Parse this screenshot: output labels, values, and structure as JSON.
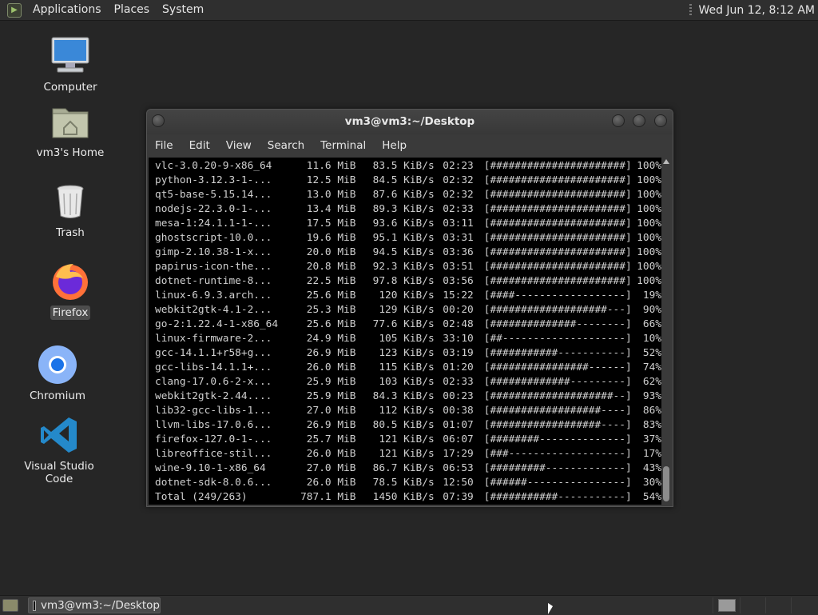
{
  "top_panel": {
    "menus": [
      "Applications",
      "Places",
      "System"
    ],
    "clock": "Wed Jun 12,  8:12 AM"
  },
  "desktop_icons": {
    "computer": "Computer",
    "home": "vm3's Home",
    "trash": "Trash",
    "firefox": "Firefox",
    "chromium": "Chromium",
    "vscode": "Visual Studio Code"
  },
  "terminal": {
    "title": "vm3@vm3:~/Desktop",
    "menu": [
      "File",
      "Edit",
      "View",
      "Search",
      "Terminal",
      "Help"
    ],
    "rows": [
      {
        "name": "vlc-3.0.20-9-x86_64",
        "size": "11.6 MiB",
        "speed": "83.5 KiB/s",
        "eta": "02:23",
        "bar": "[######################]",
        "pct": "100%"
      },
      {
        "name": "python-3.12.3-1-...",
        "size": "12.5 MiB",
        "speed": "84.5 KiB/s",
        "eta": "02:32",
        "bar": "[######################]",
        "pct": "100%"
      },
      {
        "name": "qt5-base-5.15.14...",
        "size": "13.0 MiB",
        "speed": "87.6 KiB/s",
        "eta": "02:32",
        "bar": "[######################]",
        "pct": "100%"
      },
      {
        "name": "nodejs-22.3.0-1-...",
        "size": "13.4 MiB",
        "speed": "89.3 KiB/s",
        "eta": "02:33",
        "bar": "[######################]",
        "pct": "100%"
      },
      {
        "name": "mesa-1:24.1.1-1-...",
        "size": "17.5 MiB",
        "speed": "93.6 KiB/s",
        "eta": "03:11",
        "bar": "[######################]",
        "pct": "100%"
      },
      {
        "name": "ghostscript-10.0...",
        "size": "19.6 MiB",
        "speed": "95.1 KiB/s",
        "eta": "03:31",
        "bar": "[######################]",
        "pct": "100%"
      },
      {
        "name": "gimp-2.10.38-1-x...",
        "size": "20.0 MiB",
        "speed": "94.5 KiB/s",
        "eta": "03:36",
        "bar": "[######################]",
        "pct": "100%"
      },
      {
        "name": "papirus-icon-the...",
        "size": "20.8 MiB",
        "speed": "92.3 KiB/s",
        "eta": "03:51",
        "bar": "[######################]",
        "pct": "100%"
      },
      {
        "name": "dotnet-runtime-8...",
        "size": "22.5 MiB",
        "speed": "97.8 KiB/s",
        "eta": "03:56",
        "bar": "[######################]",
        "pct": "100%"
      },
      {
        "name": "linux-6.9.3.arch...",
        "size": "25.6 MiB",
        "speed": "120 KiB/s",
        "eta": "15:22",
        "bar": "[####------------------]",
        "pct": "19%"
      },
      {
        "name": "webkit2gtk-4.1-2...",
        "size": "25.3 MiB",
        "speed": "129 KiB/s",
        "eta": "00:20",
        "bar": "[###################---]",
        "pct": "90%"
      },
      {
        "name": "go-2:1.22.4-1-x86_64",
        "size": "25.6 MiB",
        "speed": "77.6 KiB/s",
        "eta": "02:48",
        "bar": "[##############--------]",
        "pct": "66%"
      },
      {
        "name": "linux-firmware-2...",
        "size": "24.9 MiB",
        "speed": "105 KiB/s",
        "eta": "33:10",
        "bar": "[##--------------------]",
        "pct": "10%"
      },
      {
        "name": "gcc-14.1.1+r58+g...",
        "size": "26.9 MiB",
        "speed": "123 KiB/s",
        "eta": "03:19",
        "bar": "[###########-----------]",
        "pct": "52%"
      },
      {
        "name": "gcc-libs-14.1.1+...",
        "size": "26.0 MiB",
        "speed": "115 KiB/s",
        "eta": "01:20",
        "bar": "[################------]",
        "pct": "74%"
      },
      {
        "name": "clang-17.0.6-2-x...",
        "size": "25.9 MiB",
        "speed": "103 KiB/s",
        "eta": "02:33",
        "bar": "[#############---------]",
        "pct": "62%"
      },
      {
        "name": "webkit2gtk-2.44....",
        "size": "25.9 MiB",
        "speed": "84.3 KiB/s",
        "eta": "00:23",
        "bar": "[####################--]",
        "pct": "93%"
      },
      {
        "name": "lib32-gcc-libs-1...",
        "size": "27.0 MiB",
        "speed": "112 KiB/s",
        "eta": "00:38",
        "bar": "[##################----]",
        "pct": "86%"
      },
      {
        "name": "llvm-libs-17.0.6...",
        "size": "26.9 MiB",
        "speed": "80.5 KiB/s",
        "eta": "01:07",
        "bar": "[##################----]",
        "pct": "83%"
      },
      {
        "name": "firefox-127.0-1-...",
        "size": "25.7 MiB",
        "speed": "121 KiB/s",
        "eta": "06:07",
        "bar": "[########--------------]",
        "pct": "37%"
      },
      {
        "name": "libreoffice-stil...",
        "size": "26.0 MiB",
        "speed": "121 KiB/s",
        "eta": "17:29",
        "bar": "[###-------------------]",
        "pct": "17%"
      },
      {
        "name": "wine-9.10-1-x86_64",
        "size": "27.0 MiB",
        "speed": "86.7 KiB/s",
        "eta": "06:53",
        "bar": "[#########-------------]",
        "pct": "43%"
      },
      {
        "name": "dotnet-sdk-8.0.6...",
        "size": "26.0 MiB",
        "speed": "78.5 KiB/s",
        "eta": "12:50",
        "bar": "[######----------------]",
        "pct": "30%"
      },
      {
        "name": "Total (249/263)",
        "size": "787.1 MiB",
        "speed": "1450 KiB/s",
        "eta": "07:39",
        "bar": "[###########-----------]",
        "pct": "54%"
      }
    ]
  },
  "taskbar": {
    "task_label": "vm3@vm3:~/Desktop"
  }
}
